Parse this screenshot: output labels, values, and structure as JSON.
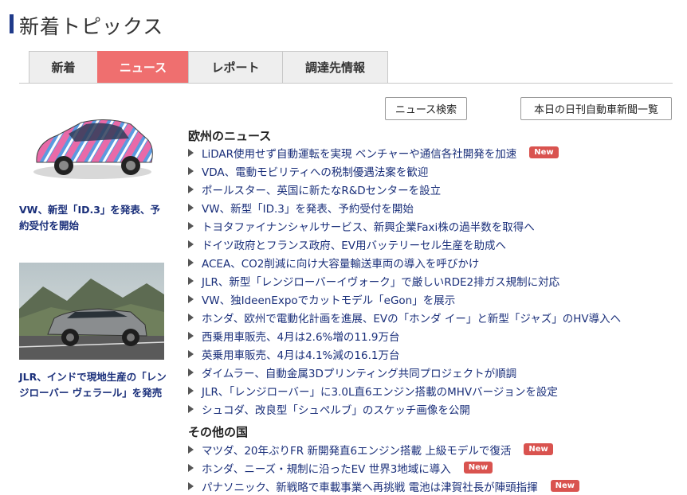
{
  "page_title": "新着トピックス",
  "tabs": [
    {
      "label": "新着",
      "active": false
    },
    {
      "label": "ニュース",
      "active": true
    },
    {
      "label": "レポート",
      "active": false
    },
    {
      "label": "調達先情報",
      "active": false
    }
  ],
  "buttons": {
    "news_search": "ニュース検索",
    "daily_list": "本日の日刊自動車新聞一覧"
  },
  "features": [
    {
      "caption": "VW、新型「ID.3」を発表、予約受付を開始"
    },
    {
      "caption": "JLR、インドで現地生産の「レンジローバー ヴェラール」を発売"
    }
  ],
  "sections": [
    {
      "heading": "欧州のニュース",
      "items": [
        {
          "text": "LiDAR使用せず自動運転を実現 ベンチャーや通信各社開発を加速",
          "badge": "New"
        },
        {
          "text": "VDA、電動モビリティへの税制優遇法案を歓迎",
          "badge": ""
        },
        {
          "text": "ポールスター、英国に新たなR&Dセンターを設立",
          "badge": ""
        },
        {
          "text": "VW、新型「ID.3」を発表、予約受付を開始",
          "badge": ""
        },
        {
          "text": "トヨタファイナンシャルサービス、新興企業Faxi株の過半数を取得へ",
          "badge": ""
        },
        {
          "text": "ドイツ政府とフランス政府、EV用バッテリーセル生産を助成へ",
          "badge": ""
        },
        {
          "text": "ACEA、CO2削減に向け大容量輸送車両の導入を呼びかけ",
          "badge": ""
        },
        {
          "text": "JLR、新型「レンジローバーイヴォーク」で厳しいRDE2排ガス規制に対応",
          "badge": ""
        },
        {
          "text": "VW、独IdeenExpoでカットモデル「eGon」を展示",
          "badge": ""
        },
        {
          "text": "ホンダ、欧州で電動化計画を進展、EVの「ホンダ イー」と新型「ジャズ」のHV導入へ",
          "badge": ""
        },
        {
          "text": "西乗用車販売、4月は2.6%増の11.9万台",
          "badge": ""
        },
        {
          "text": "英乗用車販売、4月は4.1%減の16.1万台",
          "badge": ""
        },
        {
          "text": "ダイムラー、自動金属3Dプリンティング共同プロジェクトが順調",
          "badge": ""
        },
        {
          "text": "JLR、「レンジローバー」に3.0L直6エンジン搭載のMHVバージョンを設定",
          "badge": ""
        },
        {
          "text": "シュコダ、改良型「シュペルブ」のスケッチ画像を公開",
          "badge": ""
        }
      ]
    },
    {
      "heading": "その他の国",
      "items": [
        {
          "text": "マツダ、20年ぶりFR 新開発直6エンジン搭載 上級モデルで復活",
          "badge": "New"
        },
        {
          "text": "ホンダ、ニーズ・規制に沿ったEV 世界3地域に導入",
          "badge": "New"
        },
        {
          "text": "パナソニック、新戦略で車載事業へ再挑戦 電池は津賀社長が陣頭指揮",
          "badge": "New"
        }
      ]
    }
  ]
}
